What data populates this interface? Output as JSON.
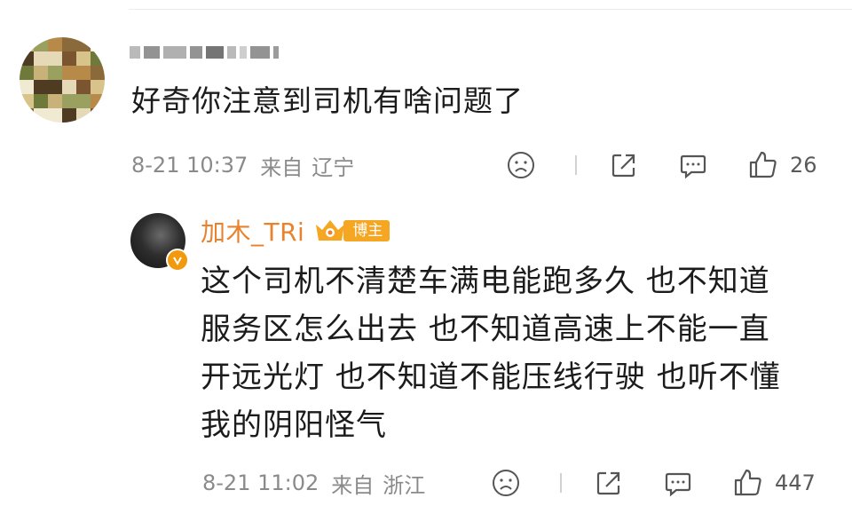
{
  "comment": {
    "text": "好奇你注意到司机有啥问题了",
    "time": "8-21 10:37",
    "from_label": "来自",
    "location": "辽宁",
    "likes": "26"
  },
  "reply": {
    "username": "加木_TRi",
    "badge_label": "博主",
    "lines": [
      "这个司机不清楚车满电能跑多久 也不知道",
      "服务区怎么出去 也不知道高速上不能一直",
      "开远光灯 也不知道不能压线行驶 也听不懂",
      "我的阴阳怪气"
    ],
    "time": "8-21 11:02",
    "from_label": "来自",
    "location": "浙江",
    "likes": "447"
  },
  "icons": {
    "dislike": "sad-face-icon",
    "share": "share-icon",
    "comment": "comment-icon",
    "like": "thumbs-up-icon"
  },
  "colors": {
    "username": "#e8822c",
    "badge": "#f5a623",
    "meta": "#8a8a8a"
  }
}
